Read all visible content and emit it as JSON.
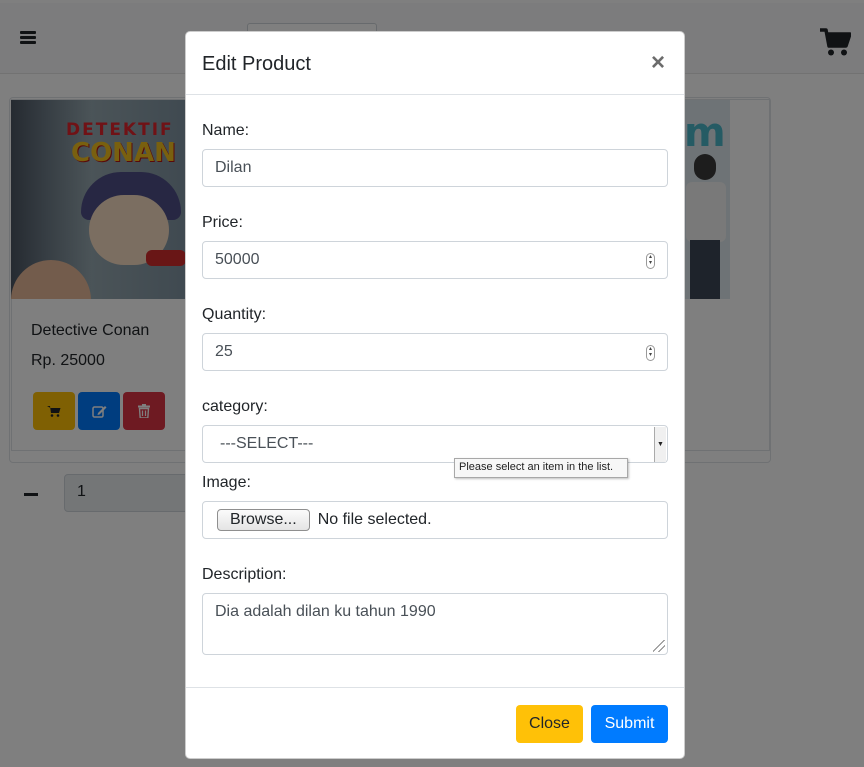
{
  "page": {
    "product": {
      "name": "Detective Conan",
      "price": "Rp. 25000",
      "cover_title": "DETEKTIF",
      "cover_subtitle": "CONAN"
    },
    "cart_quantity": "1",
    "icons": {
      "menu": "hamburger-icon",
      "cart": "shopping-cart-icon",
      "add_to_cart": "cart-icon",
      "edit": "edit-icon",
      "delete": "trash-icon",
      "minus": "minus-icon"
    },
    "colors": {
      "warning": "#ffc107",
      "primary": "#007bff",
      "danger": "#dc3545"
    }
  },
  "modal": {
    "title": "Edit Product",
    "close_symbol": "×",
    "fields": {
      "name": {
        "label": "Name:",
        "value": "Dilan"
      },
      "price": {
        "label": "Price:",
        "value": "50000"
      },
      "quantity": {
        "label": "Quantity:",
        "value": "25"
      },
      "category": {
        "label": "category:",
        "selected": "---SELECT---",
        "validation_tooltip": "Please select an item in the list."
      },
      "image": {
        "label": "Image:",
        "browse_label": "Browse...",
        "file_status": "No file selected."
      },
      "description": {
        "label": "Description:",
        "value": "Dia adalah dilan ku tahun 1990"
      }
    },
    "footer": {
      "close_label": "Close",
      "submit_label": "Submit"
    }
  }
}
